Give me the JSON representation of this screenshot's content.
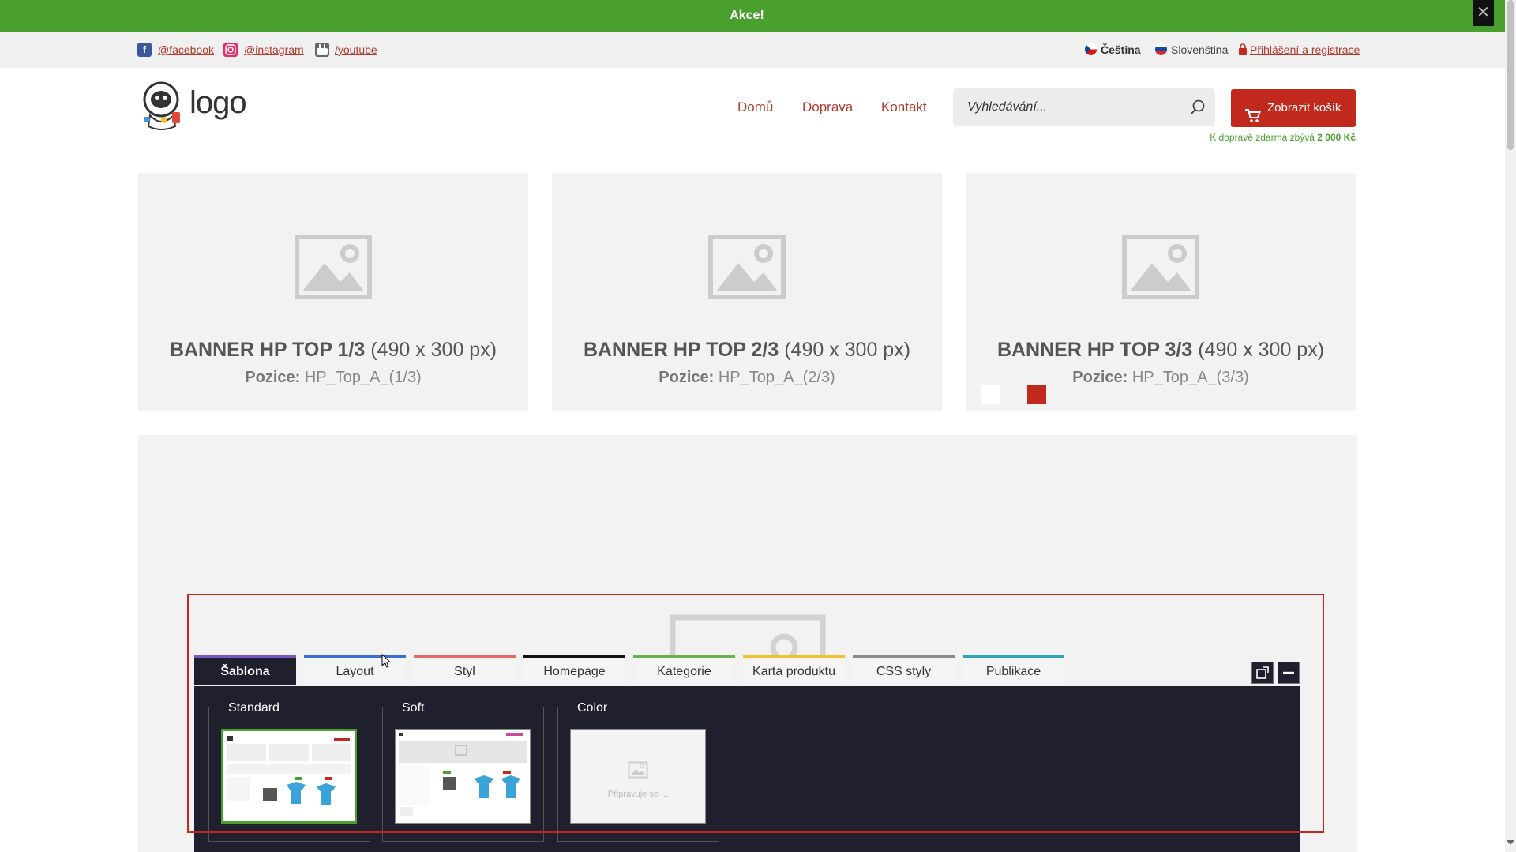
{
  "promo": {
    "text": "Akce!",
    "close": "✕"
  },
  "social": [
    {
      "label": "@facebook",
      "icon": "facebook-icon",
      "color": "#3b5998"
    },
    {
      "label": "@instagram",
      "icon": "instagram-icon",
      "color": "#e1306c"
    },
    {
      "label": "/youtube",
      "icon": "youtube-icon",
      "color": "#666666"
    }
  ],
  "languages": {
    "czech": "Čeština",
    "slovak": "Slovenština"
  },
  "login": "Přihlášení a registrace",
  "logo": {
    "text": "logo"
  },
  "nav": [
    "Domů",
    "Doprava",
    "Kontakt"
  ],
  "search": {
    "placeholder": "Vyhledávání..."
  },
  "cart": {
    "label": "Zobrazit košík"
  },
  "shipping": {
    "text": "K dopravě zdarma zbývá",
    "amount": "2 000 Kč"
  },
  "banners": [
    {
      "title": "BANNER HP TOP 1/3",
      "size": "(490 x 300 px)",
      "pos_label": "Pozice:",
      "pos": "HP_Top_A_(1/3)"
    },
    {
      "title": "BANNER HP TOP 2/3",
      "size": "(490 x 300 px)",
      "pos_label": "Pozice:",
      "pos": "HP_Top_A_(2/3)"
    },
    {
      "title": "BANNER HP TOP 3/3",
      "size": "(490 x 300 px)",
      "pos_label": "Pozice:",
      "pos": "HP_Top_A_(3/3)"
    }
  ],
  "tabs": [
    {
      "label": "Šablona",
      "color": "#7b56c8",
      "active": true
    },
    {
      "label": "Layout",
      "color": "#3a6fd1"
    },
    {
      "label": "Styl",
      "color": "#e06a6a"
    },
    {
      "label": "Homepage",
      "color": "#111111"
    },
    {
      "label": "Kategorie",
      "color": "#6ab04c"
    },
    {
      "label": "Karta produktu",
      "color": "#f0c330"
    },
    {
      "label": "CSS styly",
      "color": "#8a8a8a"
    },
    {
      "label": "Publikace",
      "color": "#2aa6b8"
    }
  ],
  "templates": [
    {
      "label": "Standard"
    },
    {
      "label": "Soft"
    },
    {
      "label": "Color",
      "placeholder": "Připravuje se ..."
    }
  ],
  "colors": {
    "accent": "#c0291c",
    "green": "#4aa02f",
    "panel": "#1f1f2e"
  }
}
